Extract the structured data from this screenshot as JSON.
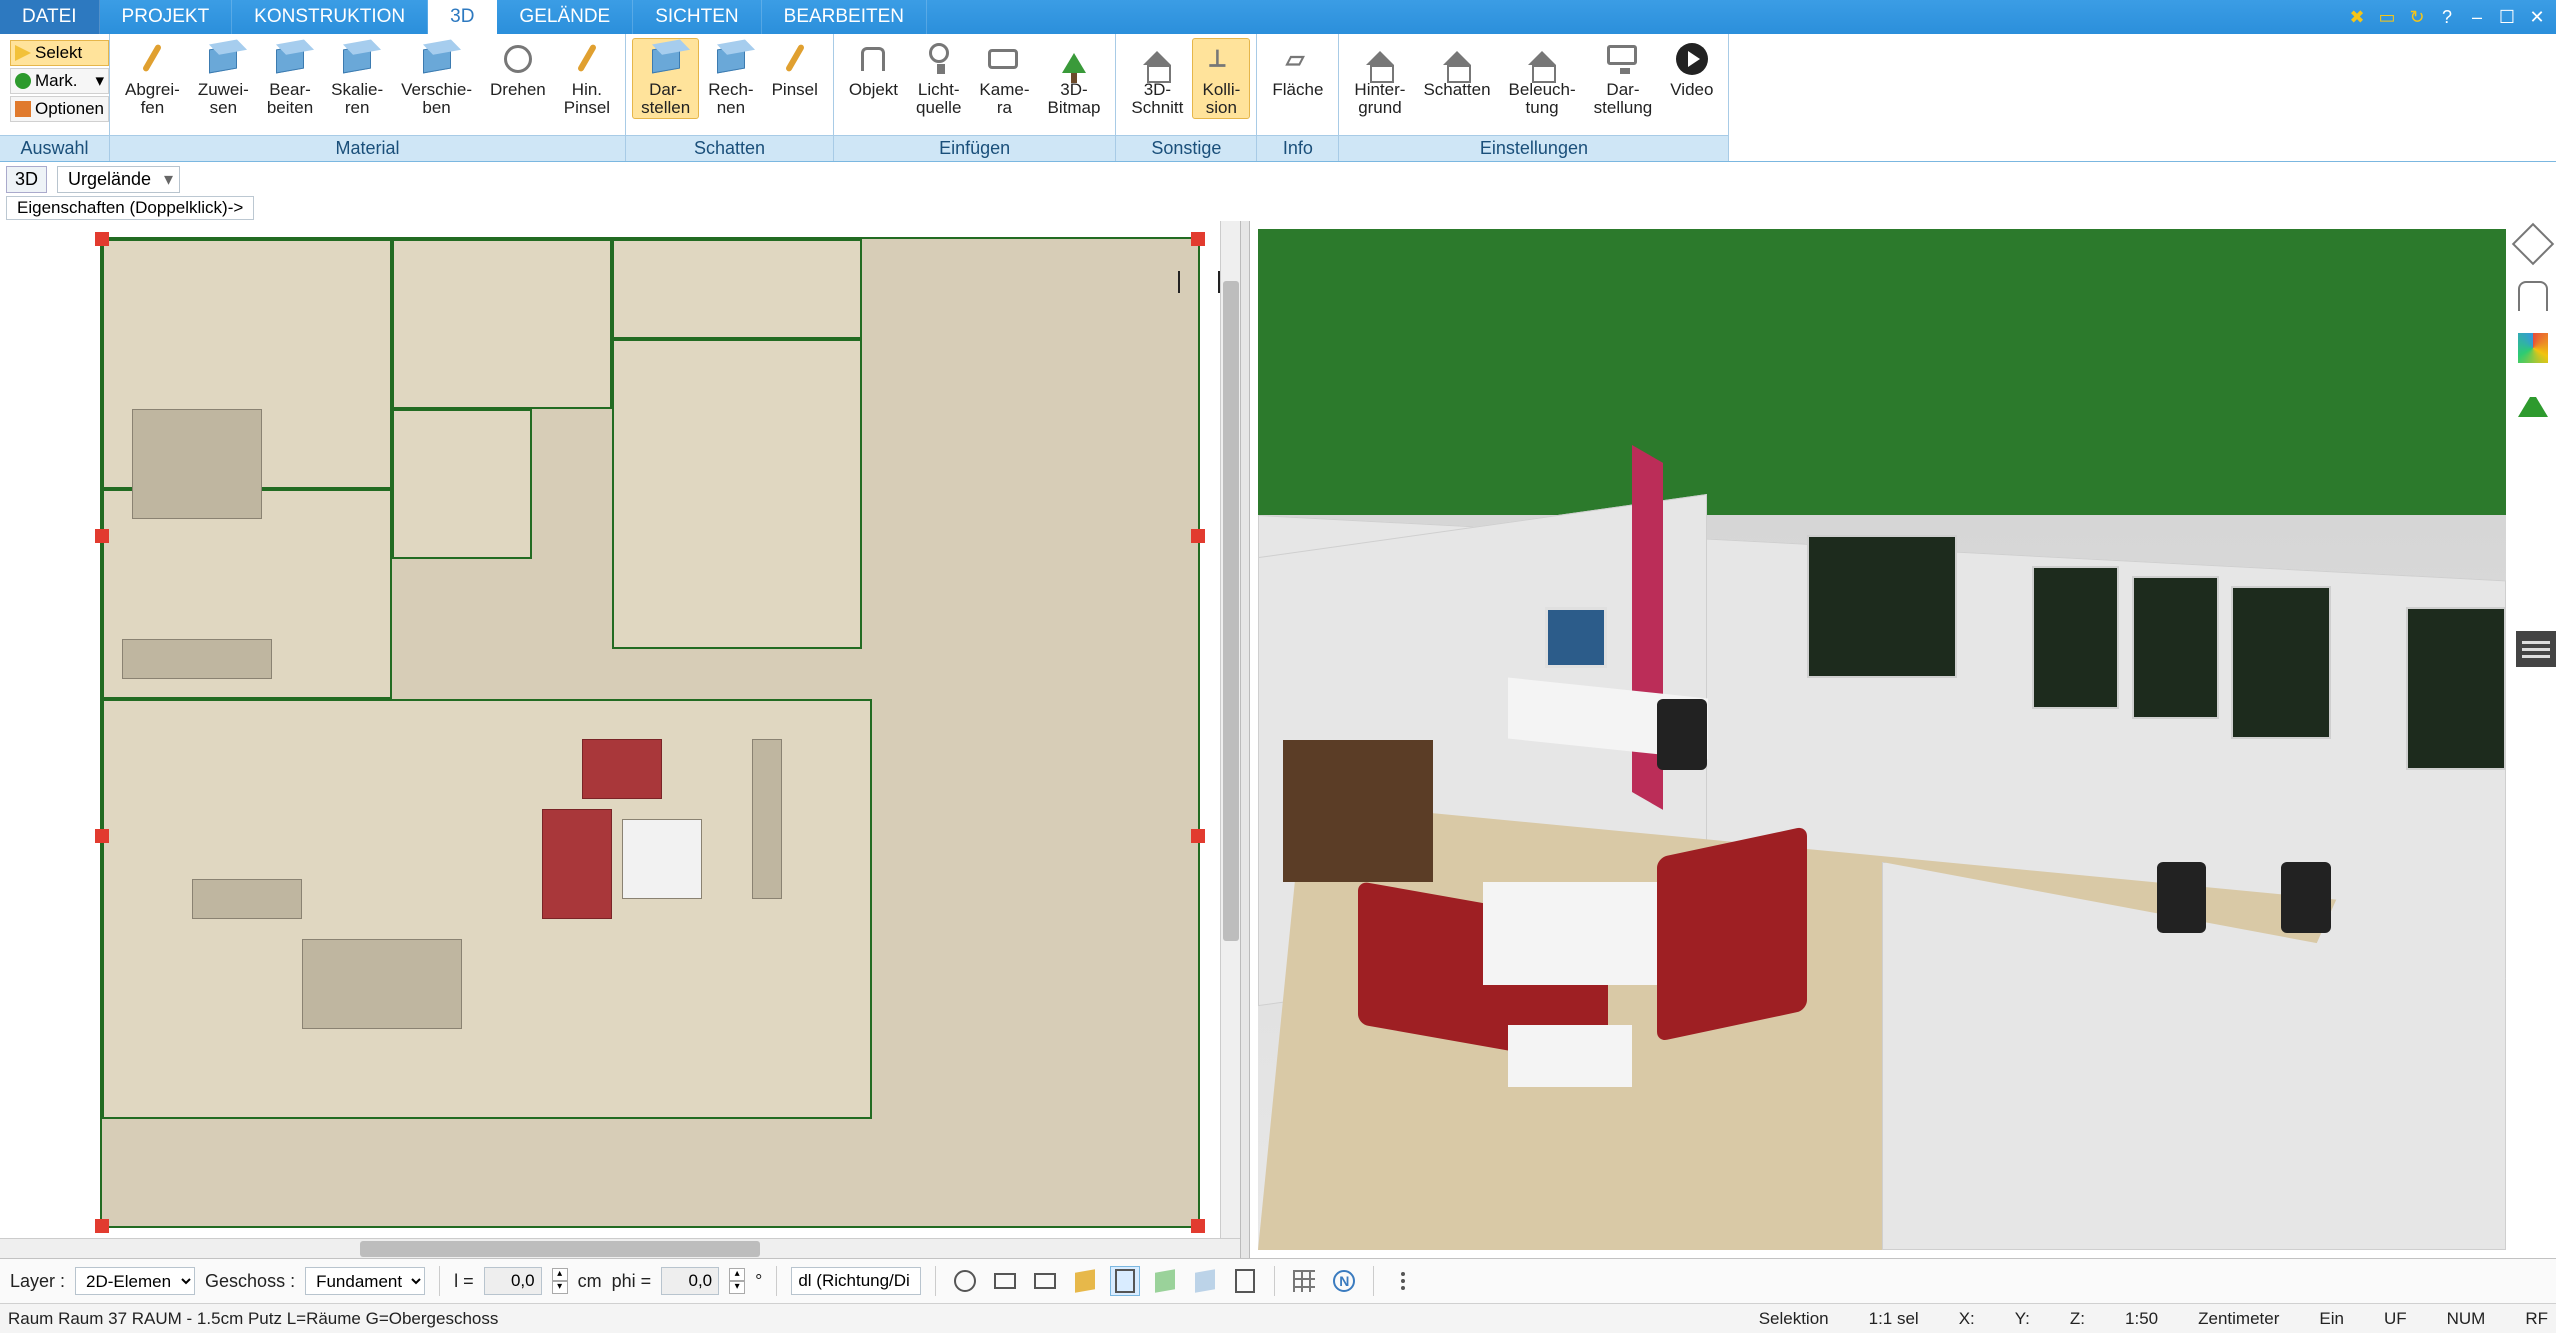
{
  "tabs": {
    "file": "DATEI",
    "projekt": "PROJEKT",
    "konstruktion": "KONSTRUKTION",
    "d3": "3D",
    "gelaende": "GELÄNDE",
    "sichten": "SICHTEN",
    "bearbeiten": "BEARBEITEN"
  },
  "ribbon": {
    "auswahl": {
      "selekt": "Selekt",
      "mark": "Mark.",
      "optionen": "Optionen",
      "label": "Auswahl"
    },
    "material": {
      "abgreifen": "Abgrei-\nfen",
      "zuweisen": "Zuwei-\nsen",
      "bearbeiten": "Bear-\nbeiten",
      "skalieren": "Skalie-\nren",
      "verschieben": "Verschie-\nben",
      "drehen": "Drehen",
      "hinpinsel": "Hin.\nPinsel",
      "label": "Material"
    },
    "schatten": {
      "darstellen": "Dar-\nstellen",
      "rechnen": "Rech-\nnen",
      "pinsel": "Pinsel",
      "label": "Schatten"
    },
    "einfuegen": {
      "objekt": "Objekt",
      "lichtquelle": "Licht-\nquelle",
      "kamera": "Kame-\nra",
      "bitmap": "3D-\nBitmap",
      "label": "Einfügen"
    },
    "sonstige": {
      "schnitt": "3D-\nSchnitt",
      "kollision": "Kolli-\nsion",
      "label": "Sonstige"
    },
    "info": {
      "flaeche": "Fläche",
      "label": "Info"
    },
    "einstellungen": {
      "hintergrund": "Hinter-\ngrund",
      "schatten": "Schatten",
      "beleuchtung": "Beleuch-\ntung",
      "darstellung": "Dar-\nstellung",
      "video": "Video",
      "label": "Einstellungen"
    }
  },
  "viewbadge": "3D",
  "viewcombo": "Urgelände",
  "propbar": "Eigenschaften (Doppelklick)->",
  "bottom": {
    "layer_lbl": "Layer :",
    "layer_val": "2D-Elemen",
    "geschoss_lbl": "Geschoss :",
    "geschoss_val": "Fundament",
    "l_lbl": "l =",
    "l_val": "0,0",
    "cm": "cm",
    "phi_lbl": "phi =",
    "phi_val": "0,0",
    "deg": "°",
    "dl": "dl (Richtung/Di"
  },
  "status": {
    "left": "Raum Raum 37 RAUM - 1.5cm Putz L=Räume G=Obergeschoss",
    "selektion": "Selektion",
    "sel": "1:1 sel",
    "x": "X:",
    "y": "Y:",
    "z": "Z:",
    "scale": "1:50",
    "unit": "Zentimeter",
    "ein": "Ein",
    "uf": "UF",
    "num": "NUM",
    "rf": "RF"
  }
}
